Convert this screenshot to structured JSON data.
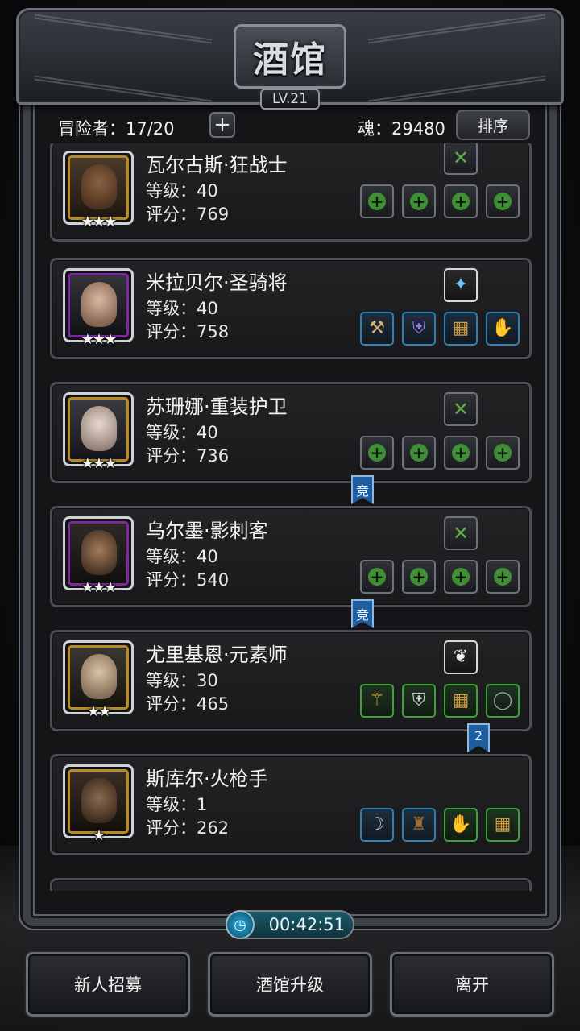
{
  "window": {
    "title": "酒馆",
    "level": "LV.21"
  },
  "header": {
    "adventurers_label": "冒险者：17/20",
    "add_label": "+",
    "soul_label": "魂：29480",
    "sort_label": "排序"
  },
  "heroes": [
    {
      "name": "瓦尔古斯·狂战士",
      "level": "等级：40",
      "score": "评分：769",
      "stars": "★★★",
      "frame": "gold"
    },
    {
      "name": "米拉贝尔·圣骑将",
      "level": "等级：40",
      "score": "评分：758",
      "stars": "★★★",
      "frame": "purple"
    },
    {
      "name": "苏珊娜·重装护卫",
      "level": "等级：40",
      "score": "评分：736",
      "stars": "★★★",
      "frame": "gold"
    },
    {
      "name": "乌尔墨·影刺客",
      "level": "等级：40",
      "score": "评分：540",
      "stars": "★★★",
      "frame": "purple"
    },
    {
      "name": "尤里基恩·元素师",
      "level": "等级：30",
      "score": "评分：465",
      "stars": "★★",
      "frame": "gold"
    },
    {
      "name": "斯库尔·火枪手",
      "level": "等级：1",
      "score": "评分：262",
      "stars": "★",
      "frame": "gold"
    }
  ],
  "ribbons": {
    "arena_1": "竞",
    "arena_2": "竞",
    "rank_badge": "2"
  },
  "footer": {
    "timer": "00:42:51",
    "recruit_label": "新人招募",
    "upgrade_label": "酒馆升级",
    "leave_label": "离开"
  },
  "icons": {
    "empty_slot": "green-plus-icon",
    "empty_skill": "green-x-icon"
  }
}
